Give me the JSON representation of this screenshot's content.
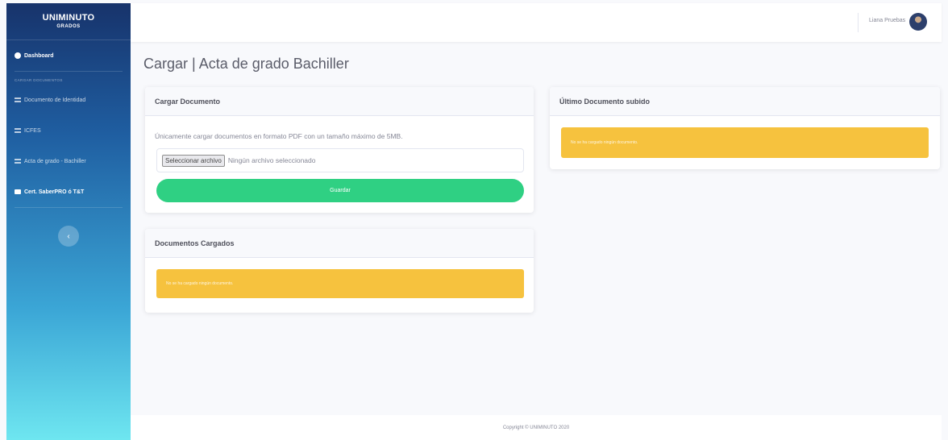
{
  "sidebar": {
    "brand": "UNIMINUTO",
    "brand_sub": "GRADOS",
    "dashboard": "Dashboard",
    "section": "CARGAR DOCUMENTOS",
    "items": [
      {
        "label": "Documento de Identidad",
        "icon": "list-icon"
      },
      {
        "label": "ICFES",
        "icon": "list-icon"
      },
      {
        "label": "Acta de grado - Bachiller",
        "icon": "list-icon"
      },
      {
        "label": "Cert. SaberPRO ó T&T",
        "icon": "folder-icon"
      }
    ],
    "toggle": "‹"
  },
  "topbar": {
    "user_name": "Liana Pruebas"
  },
  "page": {
    "title": "Cargar | Acta de grado Bachiller"
  },
  "upload_card": {
    "title": "Cargar Documento",
    "instructions": "Únicamente cargar documentos en formato PDF con un tamaño máximo de 5MB.",
    "file_button": "Seleccionar archivo",
    "file_status": "Ningún archivo seleccionado",
    "submit": "Guardar"
  },
  "loaded_card": {
    "title": "Documentos Cargados",
    "alert": "No se ha cargado ningún documento."
  },
  "last_card": {
    "title": "Último Documento subido",
    "alert": "No se ha cargado ningún documento."
  },
  "footer": {
    "copyright": "Copyright © UNIMINUTO 2020"
  },
  "colors": {
    "sidebar_top": "#17336b",
    "sidebar_bottom": "#6ee6f0",
    "success": "#2fd083",
    "warning": "#f6c23e"
  }
}
